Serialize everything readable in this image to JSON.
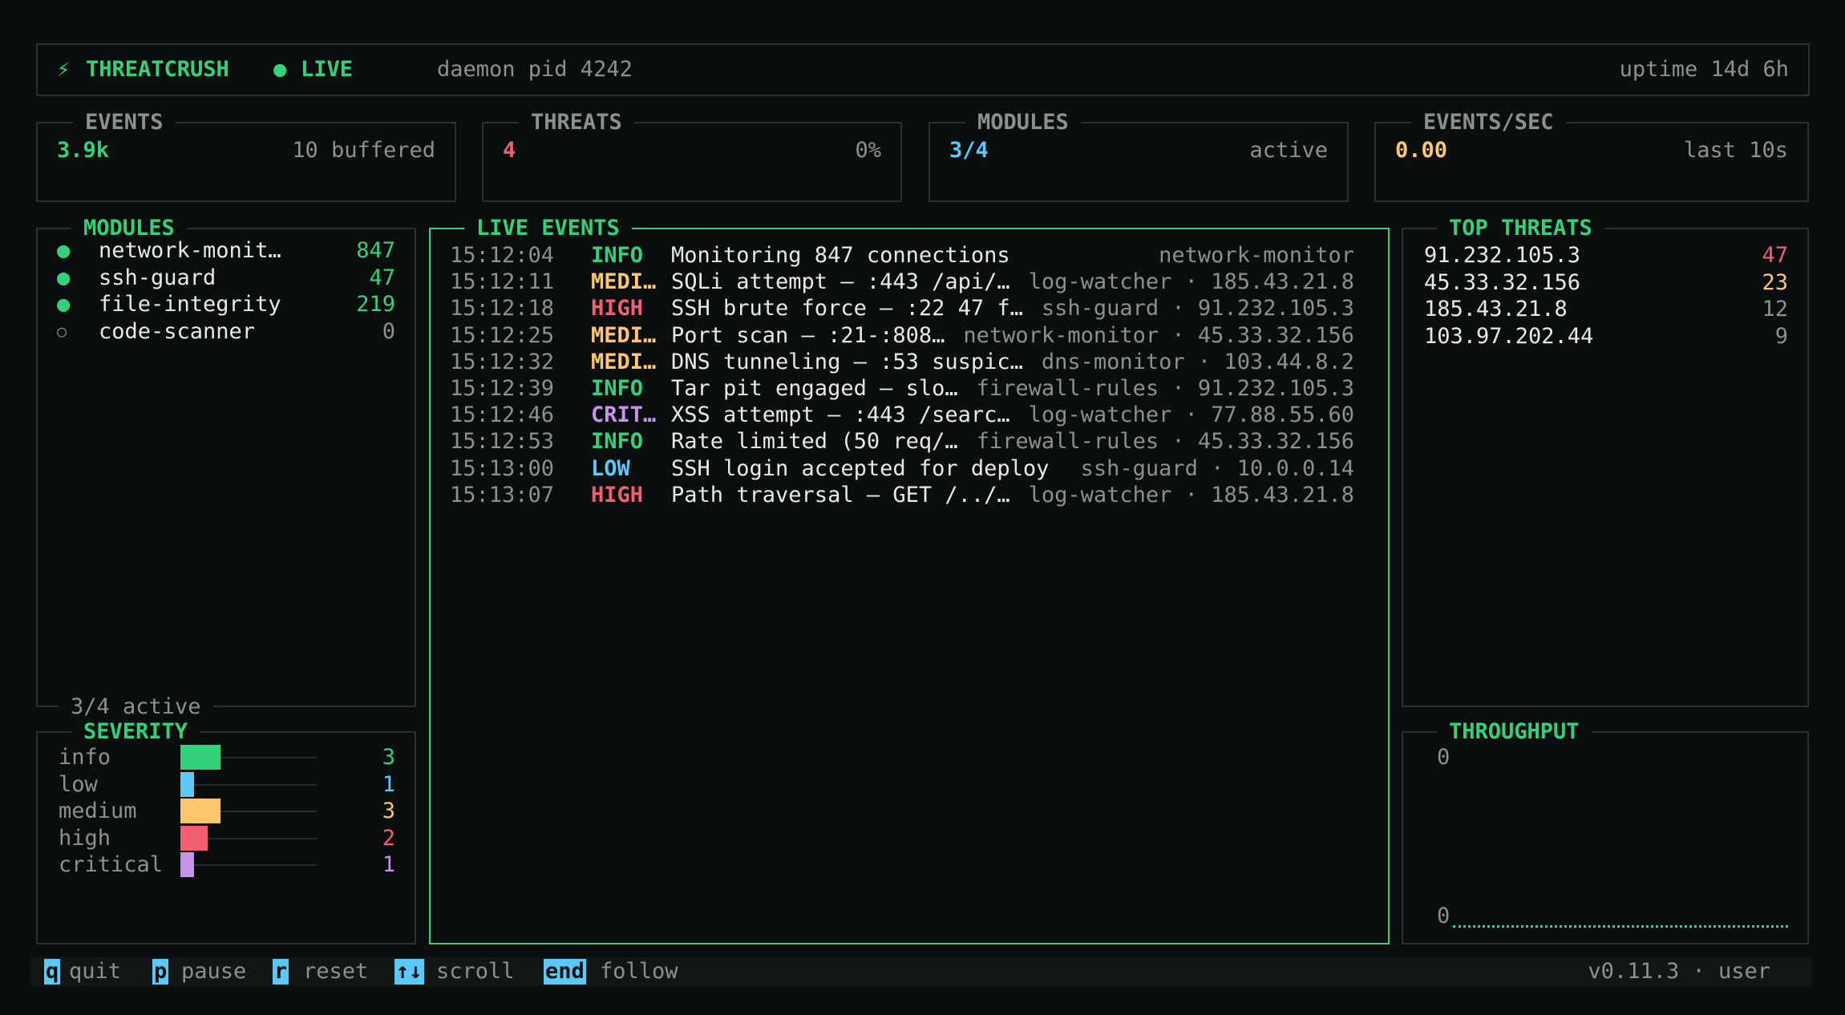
{
  "colors": {
    "accent": "#33d17a",
    "info": "#33d17a",
    "low": "#5bc8f5",
    "medium": "#ffc66d",
    "high": "#f25f72",
    "critical": "#c792ea",
    "dim": "#8b918f",
    "background": "#0b0e0e"
  },
  "header": {
    "app_name": "THREATCRUSH",
    "bolt_icon": "⚡",
    "live_dot": "●",
    "live_label": "LIVE",
    "daemon": "daemon pid 4242",
    "uptime": "uptime 14d 6h"
  },
  "stats": {
    "events": {
      "title": "EVENTS",
      "value": "3.9k",
      "sub": "10 buffered"
    },
    "threats": {
      "title": "THREATS",
      "value": "4",
      "sub": "0%"
    },
    "modules": {
      "title": "MODULES",
      "value": "3/4",
      "sub": "active"
    },
    "eps": {
      "title": "EVENTS/SEC",
      "value": "0.00",
      "sub": "last 10s"
    }
  },
  "modules": {
    "title": "MODULES",
    "footer": "3/4 active",
    "items": [
      {
        "dot": "●",
        "name": "network-monit…",
        "count": "847",
        "active": true
      },
      {
        "dot": "●",
        "name": "ssh-guard",
        "count": "47",
        "active": true
      },
      {
        "dot": "●",
        "name": "file-integrity",
        "count": "219",
        "active": true
      },
      {
        "dot": "○",
        "name": "code-scanner",
        "count": "0",
        "active": false
      }
    ]
  },
  "severity": {
    "title": "SEVERITY",
    "items": [
      {
        "label": "info",
        "count": "3",
        "fraction": 0.21,
        "color": "#33d17a"
      },
      {
        "label": "low",
        "count": "1",
        "fraction": 0.07,
        "color": "#5bc8f5"
      },
      {
        "label": "medium",
        "count": "3",
        "fraction": 0.21,
        "color": "#ffc66d"
      },
      {
        "label": "high",
        "count": "2",
        "fraction": 0.14,
        "color": "#f25f72"
      },
      {
        "label": "critical",
        "count": "1",
        "fraction": 0.07,
        "color": "#c792ea"
      }
    ]
  },
  "live_events": {
    "title": "LIVE EVENTS",
    "rows": [
      {
        "time": "15:12:04",
        "sev": "INFO",
        "color": "#33d17a",
        "msg": "Monitoring 847 connections",
        "src": "network-monitor"
      },
      {
        "time": "15:12:11",
        "sev": "MEDI…",
        "color": "#ffc66d",
        "msg": "SQLi attempt — :443 /api/…",
        "src": "log-watcher · 185.43.21.8"
      },
      {
        "time": "15:12:18",
        "sev": "HIGH",
        "color": "#f25f72",
        "msg": "SSH brute force — :22 47 f…",
        "src": "ssh-guard · 91.232.105.3"
      },
      {
        "time": "15:12:25",
        "sev": "MEDI…",
        "color": "#ffc66d",
        "msg": "Port scan — :21-:808…",
        "src": "network-monitor · 45.33.32.156"
      },
      {
        "time": "15:12:32",
        "sev": "MEDI…",
        "color": "#ffc66d",
        "msg": "DNS tunneling — :53 suspic…",
        "src": "dns-monitor · 103.44.8.2"
      },
      {
        "time": "15:12:39",
        "sev": "INFO",
        "color": "#33d17a",
        "msg": "Tar pit engaged — slo…",
        "src": "firewall-rules · 91.232.105.3"
      },
      {
        "time": "15:12:46",
        "sev": "CRIT…",
        "color": "#c792ea",
        "msg": "XSS attempt — :443 /searc…",
        "src": "log-watcher · 77.88.55.60"
      },
      {
        "time": "15:12:53",
        "sev": "INFO",
        "color": "#33d17a",
        "msg": "Rate limited (50 req/…",
        "src": "firewall-rules · 45.33.32.156"
      },
      {
        "time": "15:13:00",
        "sev": "LOW",
        "color": "#5bc8f5",
        "msg": "SSH login accepted for deploy",
        "src": "ssh-guard · 10.0.0.14"
      },
      {
        "time": "15:13:07",
        "sev": "HIGH",
        "color": "#f25f72",
        "msg": "Path traversal — GET /../…",
        "src": "log-watcher · 185.43.21.8"
      }
    ]
  },
  "top_threats": {
    "title": "TOP THREATS",
    "rows": [
      {
        "ip": "91.232.105.3",
        "count": "47",
        "color": "#f25f72"
      },
      {
        "ip": "45.33.32.156",
        "count": "23",
        "color": "#ffc66d"
      },
      {
        "ip": "185.43.21.8",
        "count": "12",
        "color": "#8b918f"
      },
      {
        "ip": "103.97.202.44",
        "count": "9",
        "color": "#8b918f"
      }
    ]
  },
  "throughput": {
    "title": "THROUGHPUT",
    "y_max": "0",
    "y_min": "0"
  },
  "footer": {
    "keys": [
      {
        "key": "q",
        "label": "quit"
      },
      {
        "key": "p",
        "label": "pause"
      },
      {
        "key": "r",
        "label": "reset"
      },
      {
        "key": "↑↓",
        "label": "scroll"
      },
      {
        "key": "end",
        "label": "follow"
      }
    ],
    "version": "v0.11.3 · user"
  }
}
